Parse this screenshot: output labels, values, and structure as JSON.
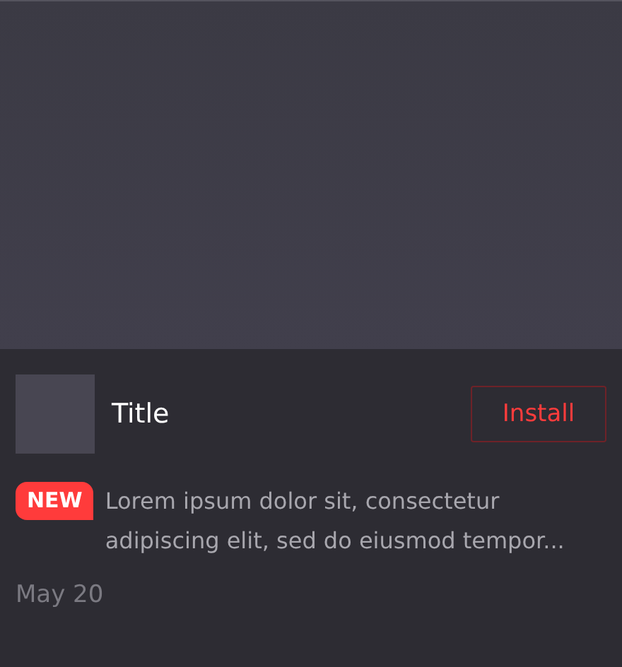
{
  "app": {
    "title": "Title",
    "install_button": "Install",
    "badge": "NEW",
    "description": "Lorem ipsum dolor sit, consectetur adipiscing elit, sed do eiusmod tempor...",
    "date": "May 20"
  }
}
